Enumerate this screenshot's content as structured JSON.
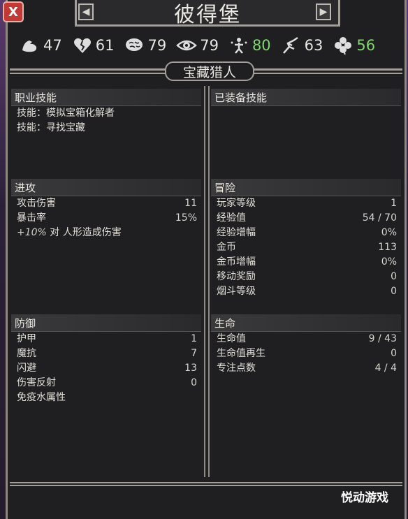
{
  "window": {
    "title": "彼得堡",
    "close_label": "X"
  },
  "stats": [
    {
      "icon": "strength-icon",
      "value": "47",
      "color": "#e8e6e1"
    },
    {
      "icon": "broken-heart-icon",
      "value": "61",
      "color": "#e8e6e1"
    },
    {
      "icon": "brain-icon",
      "value": "79",
      "color": "#e8e6e1"
    },
    {
      "icon": "eye-icon",
      "value": "79",
      "color": "#e8e6e1"
    },
    {
      "icon": "spirit-icon",
      "value": "80",
      "color": "#7fd66b"
    },
    {
      "icon": "agility-icon",
      "value": "63",
      "color": "#e8e6e1"
    },
    {
      "icon": "clover-icon",
      "value": "56",
      "color": "#7fd66b"
    }
  ],
  "class_name": "宝藏猎人",
  "job_skills": {
    "header": "职业技能",
    "items": [
      "技能：模拟宝箱化解者",
      "技能：寻找宝藏"
    ]
  },
  "equipped_skills": {
    "header": "已装备技能"
  },
  "attack": {
    "header": "进攻",
    "rows": [
      {
        "label": "攻击伤害",
        "value": "11"
      },
      {
        "label": "暴击率",
        "value": "15%"
      }
    ],
    "bonus_pct": "+10%",
    "bonus_text": " 对 人形造成伤害"
  },
  "adventure": {
    "header": "冒险",
    "rows": [
      {
        "label": "玩家等级",
        "value": "1"
      },
      {
        "label": "经验值",
        "value": "54 / 70"
      },
      {
        "label": "经验增幅",
        "value": "0%"
      },
      {
        "label": "金币",
        "value": "113"
      },
      {
        "label": "金币增幅",
        "value": "0%"
      },
      {
        "label": "移动奖励",
        "value": "0"
      },
      {
        "label": "烟斗等级",
        "value": "0"
      }
    ]
  },
  "defense": {
    "header": "防御",
    "rows": [
      {
        "label": "护甲",
        "value": "1"
      },
      {
        "label": "魔抗",
        "value": "7"
      },
      {
        "label": "闪避",
        "value": "13"
      },
      {
        "label": "伤害反射",
        "value": "0"
      },
      {
        "label": "免疫水属性",
        "value": ""
      }
    ]
  },
  "life": {
    "header": "生命",
    "rows": [
      {
        "label": "生命值",
        "value": "9 / 43"
      },
      {
        "label": "生命值再生",
        "value": "0"
      },
      {
        "label": "专注点数",
        "value": "4 / 4"
      }
    ]
  },
  "watermark": "悦动游戏"
}
